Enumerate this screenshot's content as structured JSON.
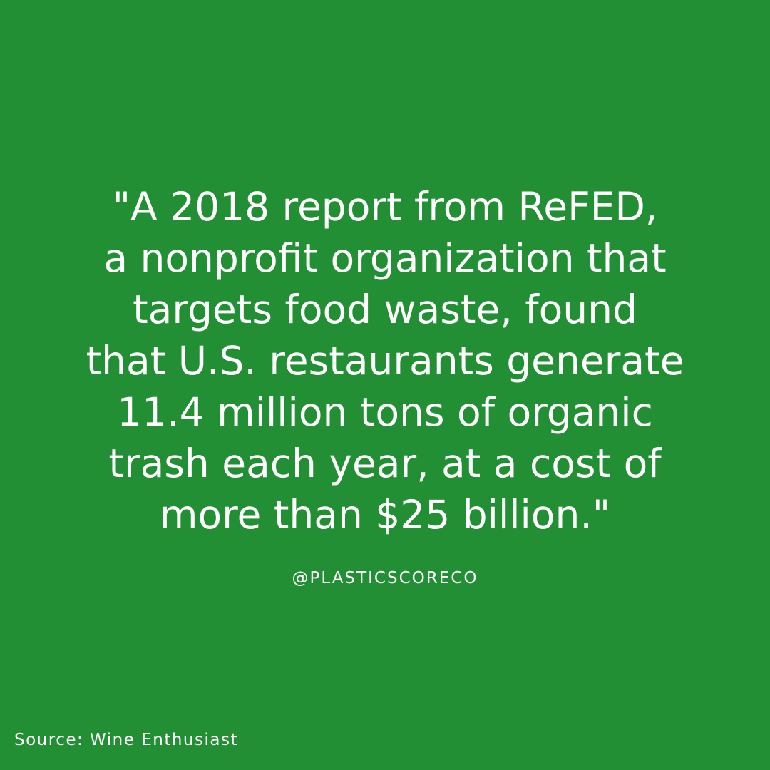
{
  "background_color": "#238f34",
  "text_color": "#ffffff",
  "quote": {
    "lines": [
      "\"A 2018 report from ReFED,",
      "a nonprofit organization that",
      "targets food waste, found",
      "that U.S. restaurants generate",
      "11.4 million tons of organic",
      "trash each year, at a cost of",
      "more than $25 billion.\""
    ]
  },
  "handle": "@PLASTICSCORECO",
  "source": "Source: Wine Enthusiast"
}
